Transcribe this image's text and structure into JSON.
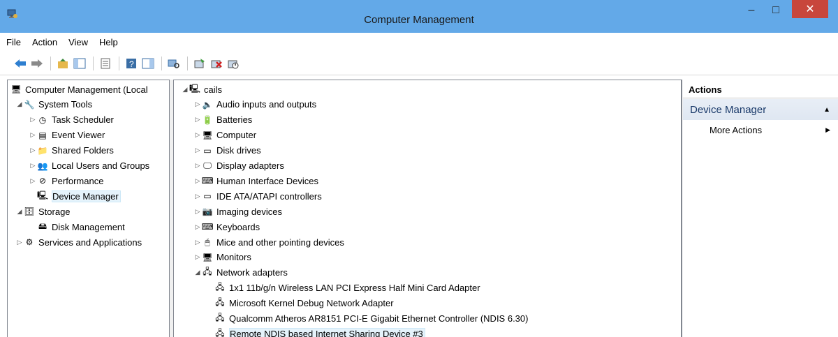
{
  "window": {
    "title": "Computer Management",
    "minimize": "–",
    "maximize": "□",
    "close": "✕"
  },
  "menu": [
    "File",
    "Action",
    "View",
    "Help"
  ],
  "toolbar_icons": [
    "back-arrow-icon",
    "forward-arrow-icon",
    "sep",
    "up-folder-icon",
    "show-hide-tree-icon",
    "sep",
    "properties-icon",
    "sep",
    "help-icon",
    "show-action-pane-icon",
    "sep",
    "scan-hardware-icon",
    "sep",
    "update-driver-icon",
    "uninstall-device-icon",
    "disable-device-icon"
  ],
  "left_tree": [
    {
      "label": "Computer Management (Local",
      "depth": 0,
      "arrow": "",
      "icon": "computer-management-icon",
      "glyph": "🖥"
    },
    {
      "label": "System Tools",
      "depth": 1,
      "arrow": "◢",
      "icon": "system-tools-icon",
      "glyph": "🔧"
    },
    {
      "label": "Task Scheduler",
      "depth": 2,
      "arrow": "▷",
      "icon": "task-scheduler-icon",
      "glyph": "◷"
    },
    {
      "label": "Event Viewer",
      "depth": 2,
      "arrow": "▷",
      "icon": "event-viewer-icon",
      "glyph": "▤"
    },
    {
      "label": "Shared Folders",
      "depth": 2,
      "arrow": "▷",
      "icon": "shared-folders-icon",
      "glyph": "📁"
    },
    {
      "label": "Local Users and Groups",
      "depth": 2,
      "arrow": "▷",
      "icon": "local-users-icon",
      "glyph": "👥"
    },
    {
      "label": "Performance",
      "depth": 2,
      "arrow": "▷",
      "icon": "performance-icon",
      "glyph": "⊘"
    },
    {
      "label": "Device Manager",
      "depth": 2,
      "arrow": "",
      "icon": "device-manager-icon",
      "glyph": "🖳",
      "selected": true
    },
    {
      "label": "Storage",
      "depth": 1,
      "arrow": "◢",
      "icon": "storage-icon",
      "glyph": "🗄"
    },
    {
      "label": "Disk Management",
      "depth": 2,
      "arrow": "",
      "icon": "disk-management-icon",
      "glyph": "🖴"
    },
    {
      "label": "Services and Applications",
      "depth": 1,
      "arrow": "▷",
      "icon": "services-apps-icon",
      "glyph": "⚙"
    }
  ],
  "device_tree": [
    {
      "label": "cails",
      "depth": 0,
      "arrow": "◢",
      "icon": "computer-icon",
      "glyph": "🖳"
    },
    {
      "label": "Audio inputs and outputs",
      "depth": 1,
      "arrow": "▷",
      "icon": "speaker-icon",
      "glyph": "🔈"
    },
    {
      "label": "Batteries",
      "depth": 1,
      "arrow": "▷",
      "icon": "battery-icon",
      "glyph": "🔋"
    },
    {
      "label": "Computer",
      "depth": 1,
      "arrow": "▷",
      "icon": "monitor-icon",
      "glyph": "🖥"
    },
    {
      "label": "Disk drives",
      "depth": 1,
      "arrow": "▷",
      "icon": "disk-drive-icon",
      "glyph": "▭"
    },
    {
      "label": "Display adapters",
      "depth": 1,
      "arrow": "▷",
      "icon": "display-adapter-icon",
      "glyph": "🖵"
    },
    {
      "label": "Human Interface Devices",
      "depth": 1,
      "arrow": "▷",
      "icon": "hid-icon",
      "glyph": "⌨"
    },
    {
      "label": "IDE ATA/ATAPI controllers",
      "depth": 1,
      "arrow": "▷",
      "icon": "ide-controller-icon",
      "glyph": "▭"
    },
    {
      "label": "Imaging devices",
      "depth": 1,
      "arrow": "▷",
      "icon": "camera-icon",
      "glyph": "📷"
    },
    {
      "label": "Keyboards",
      "depth": 1,
      "arrow": "▷",
      "icon": "keyboard-icon",
      "glyph": "⌨"
    },
    {
      "label": "Mice and other pointing devices",
      "depth": 1,
      "arrow": "▷",
      "icon": "mouse-icon",
      "glyph": "🖱"
    },
    {
      "label": "Monitors",
      "depth": 1,
      "arrow": "▷",
      "icon": "monitor-icon",
      "glyph": "🖥"
    },
    {
      "label": "Network adapters",
      "depth": 1,
      "arrow": "◢",
      "icon": "network-adapter-icon",
      "glyph": "🖧"
    },
    {
      "label": "1x1 11b/g/n Wireless LAN PCI Express Half Mini Card Adapter",
      "depth": 2,
      "arrow": "",
      "icon": "network-adapter-icon",
      "glyph": "🖧"
    },
    {
      "label": "Microsoft Kernel Debug Network Adapter",
      "depth": 2,
      "arrow": "",
      "icon": "network-adapter-icon",
      "glyph": "🖧"
    },
    {
      "label": "Qualcomm Atheros AR8151 PCI-E Gigabit Ethernet Controller (NDIS 6.30)",
      "depth": 2,
      "arrow": "",
      "icon": "network-adapter-icon",
      "glyph": "🖧"
    },
    {
      "label": "Remote NDIS based Internet Sharing Device #3",
      "depth": 2,
      "arrow": "",
      "icon": "network-adapter-icon",
      "glyph": "🖧",
      "selected": true
    }
  ],
  "actions": {
    "header": "Actions",
    "section": "Device Manager",
    "more": "More Actions"
  }
}
